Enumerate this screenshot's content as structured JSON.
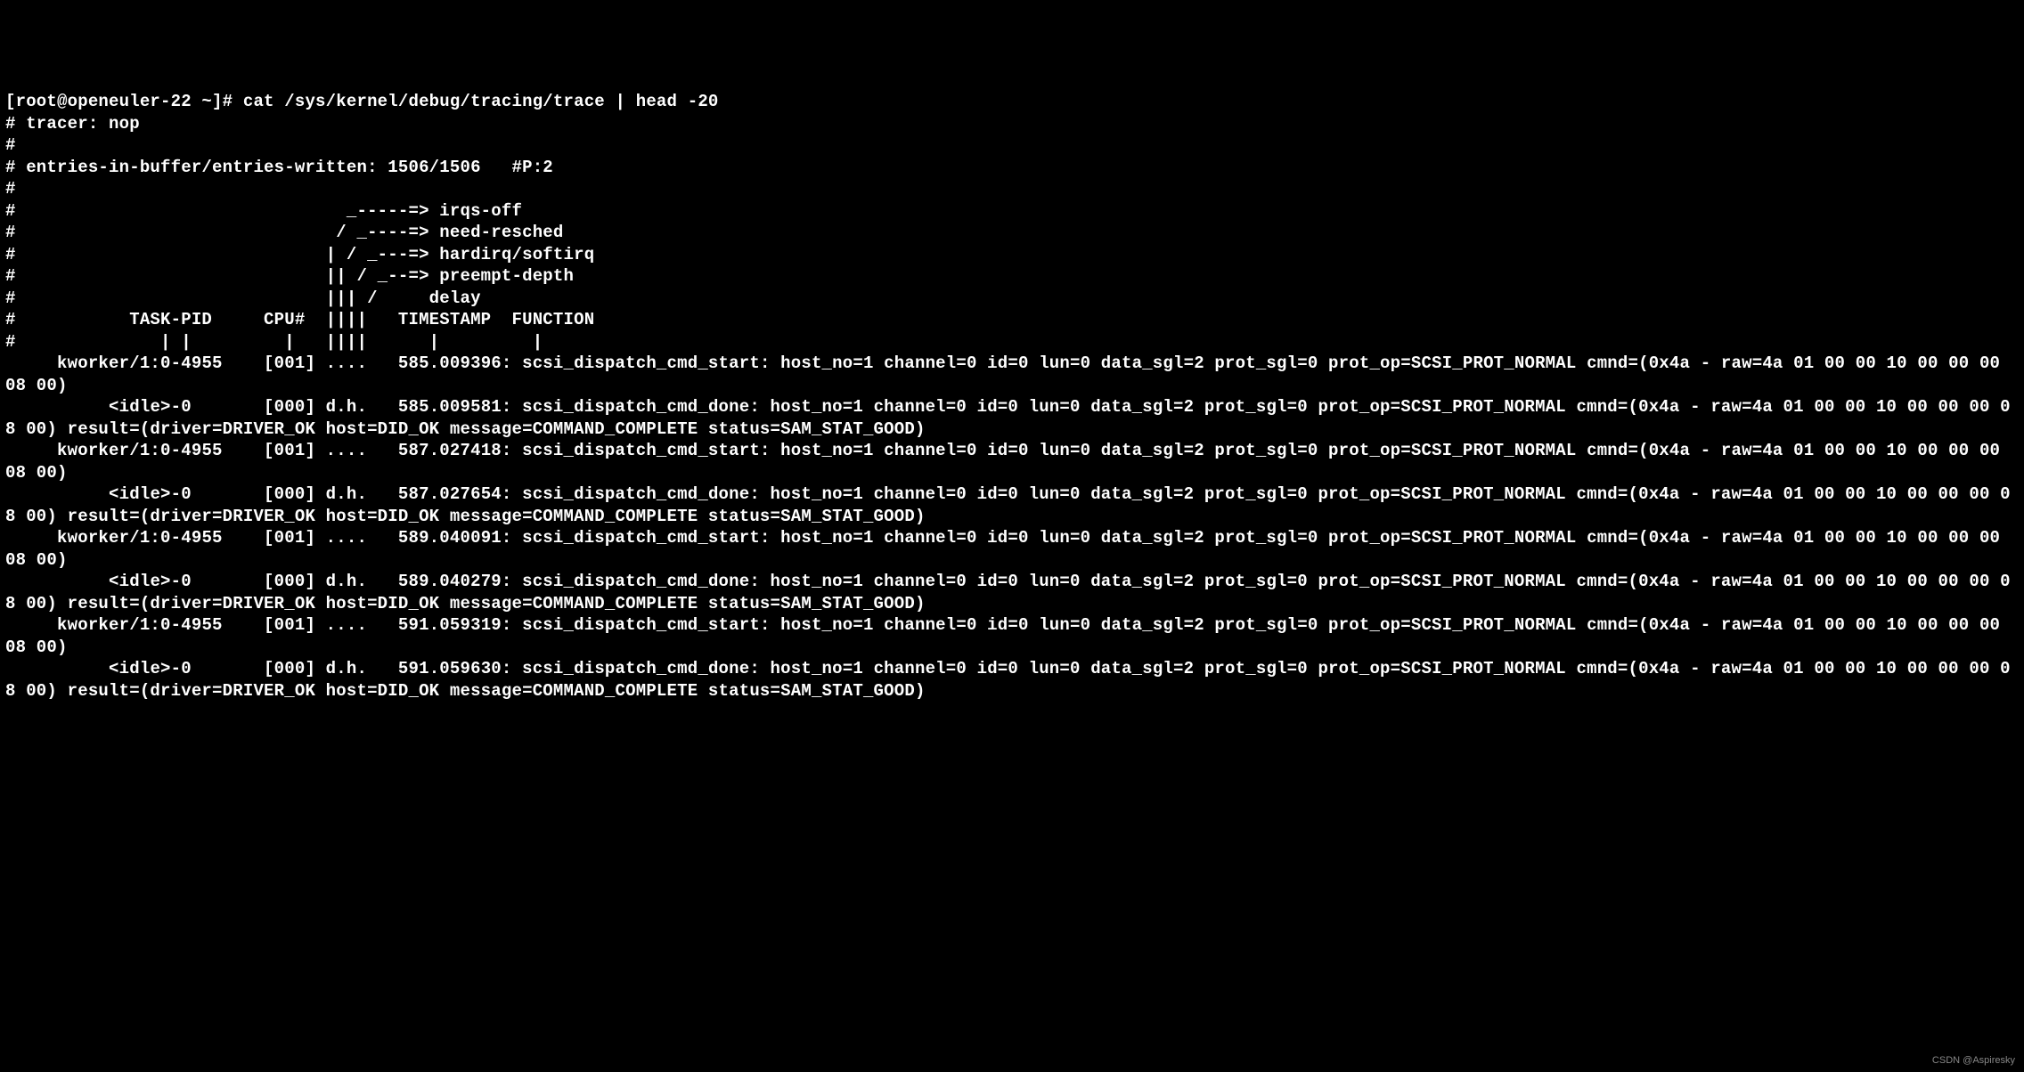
{
  "terminal": {
    "prompt": "[root@openeuler-22 ~]# ",
    "command": "cat /sys/kernel/debug/tracing/trace | head -20",
    "header": {
      "line1": "# tracer: nop",
      "line2": "#",
      "line3": "# entries-in-buffer/entries-written: 1506/1506   #P:2",
      "line4": "#",
      "line5": "#                                _-----=> irqs-off",
      "line6": "#                               / _----=> need-resched",
      "line7": "#                              | / _---=> hardirq/softirq",
      "line8": "#                              || / _--=> preempt-depth",
      "line9": "#                              ||| /     delay",
      "line10": "#           TASK-PID     CPU#  ||||   TIMESTAMP  FUNCTION",
      "line11": "#              | |         |   ||||      |         |"
    },
    "entries": {
      "e1": "     kworker/1:0-4955    [001] ....   585.009396: scsi_dispatch_cmd_start: host_no=1 channel=0 id=0 lun=0 data_sgl=2 prot_sgl=0 prot_op=SCSI_PROT_NORMAL cmnd=(0x4a - raw=4a 01 00 00 10 00 00 00 08 00)",
      "e2": "          <idle>-0       [000] d.h.   585.009581: scsi_dispatch_cmd_done: host_no=1 channel=0 id=0 lun=0 data_sgl=2 prot_sgl=0 prot_op=SCSI_PROT_NORMAL cmnd=(0x4a - raw=4a 01 00 00 10 00 00 00 08 00) result=(driver=DRIVER_OK host=DID_OK message=COMMAND_COMPLETE status=SAM_STAT_GOOD)",
      "e3": "     kworker/1:0-4955    [001] ....   587.027418: scsi_dispatch_cmd_start: host_no=1 channel=0 id=0 lun=0 data_sgl=2 prot_sgl=0 prot_op=SCSI_PROT_NORMAL cmnd=(0x4a - raw=4a 01 00 00 10 00 00 00 08 00)",
      "e4": "          <idle>-0       [000] d.h.   587.027654: scsi_dispatch_cmd_done: host_no=1 channel=0 id=0 lun=0 data_sgl=2 prot_sgl=0 prot_op=SCSI_PROT_NORMAL cmnd=(0x4a - raw=4a 01 00 00 10 00 00 00 08 00) result=(driver=DRIVER_OK host=DID_OK message=COMMAND_COMPLETE status=SAM_STAT_GOOD)",
      "e5": "     kworker/1:0-4955    [001] ....   589.040091: scsi_dispatch_cmd_start: host_no=1 channel=0 id=0 lun=0 data_sgl=2 prot_sgl=0 prot_op=SCSI_PROT_NORMAL cmnd=(0x4a - raw=4a 01 00 00 10 00 00 00 08 00)",
      "e6": "          <idle>-0       [000] d.h.   589.040279: scsi_dispatch_cmd_done: host_no=1 channel=0 id=0 lun=0 data_sgl=2 prot_sgl=0 prot_op=SCSI_PROT_NORMAL cmnd=(0x4a - raw=4a 01 00 00 10 00 00 00 08 00) result=(driver=DRIVER_OK host=DID_OK message=COMMAND_COMPLETE status=SAM_STAT_GOOD)",
      "e7": "     kworker/1:0-4955    [001] ....   591.059319: scsi_dispatch_cmd_start: host_no=1 channel=0 id=0 lun=0 data_sgl=2 prot_sgl=0 prot_op=SCSI_PROT_NORMAL cmnd=(0x4a - raw=4a 01 00 00 10 00 00 00 08 00)",
      "e8": "          <idle>-0       [000] d.h.   591.059630: scsi_dispatch_cmd_done: host_no=1 channel=0 id=0 lun=0 data_sgl=2 prot_sgl=0 prot_op=SCSI_PROT_NORMAL cmnd=(0x4a - raw=4a 01 00 00 10 00 00 00 08 00) result=(driver=DRIVER_OK host=DID_OK message=COMMAND_COMPLETE status=SAM_STAT_GOOD)"
    }
  },
  "watermark": "CSDN @Aspiresky"
}
